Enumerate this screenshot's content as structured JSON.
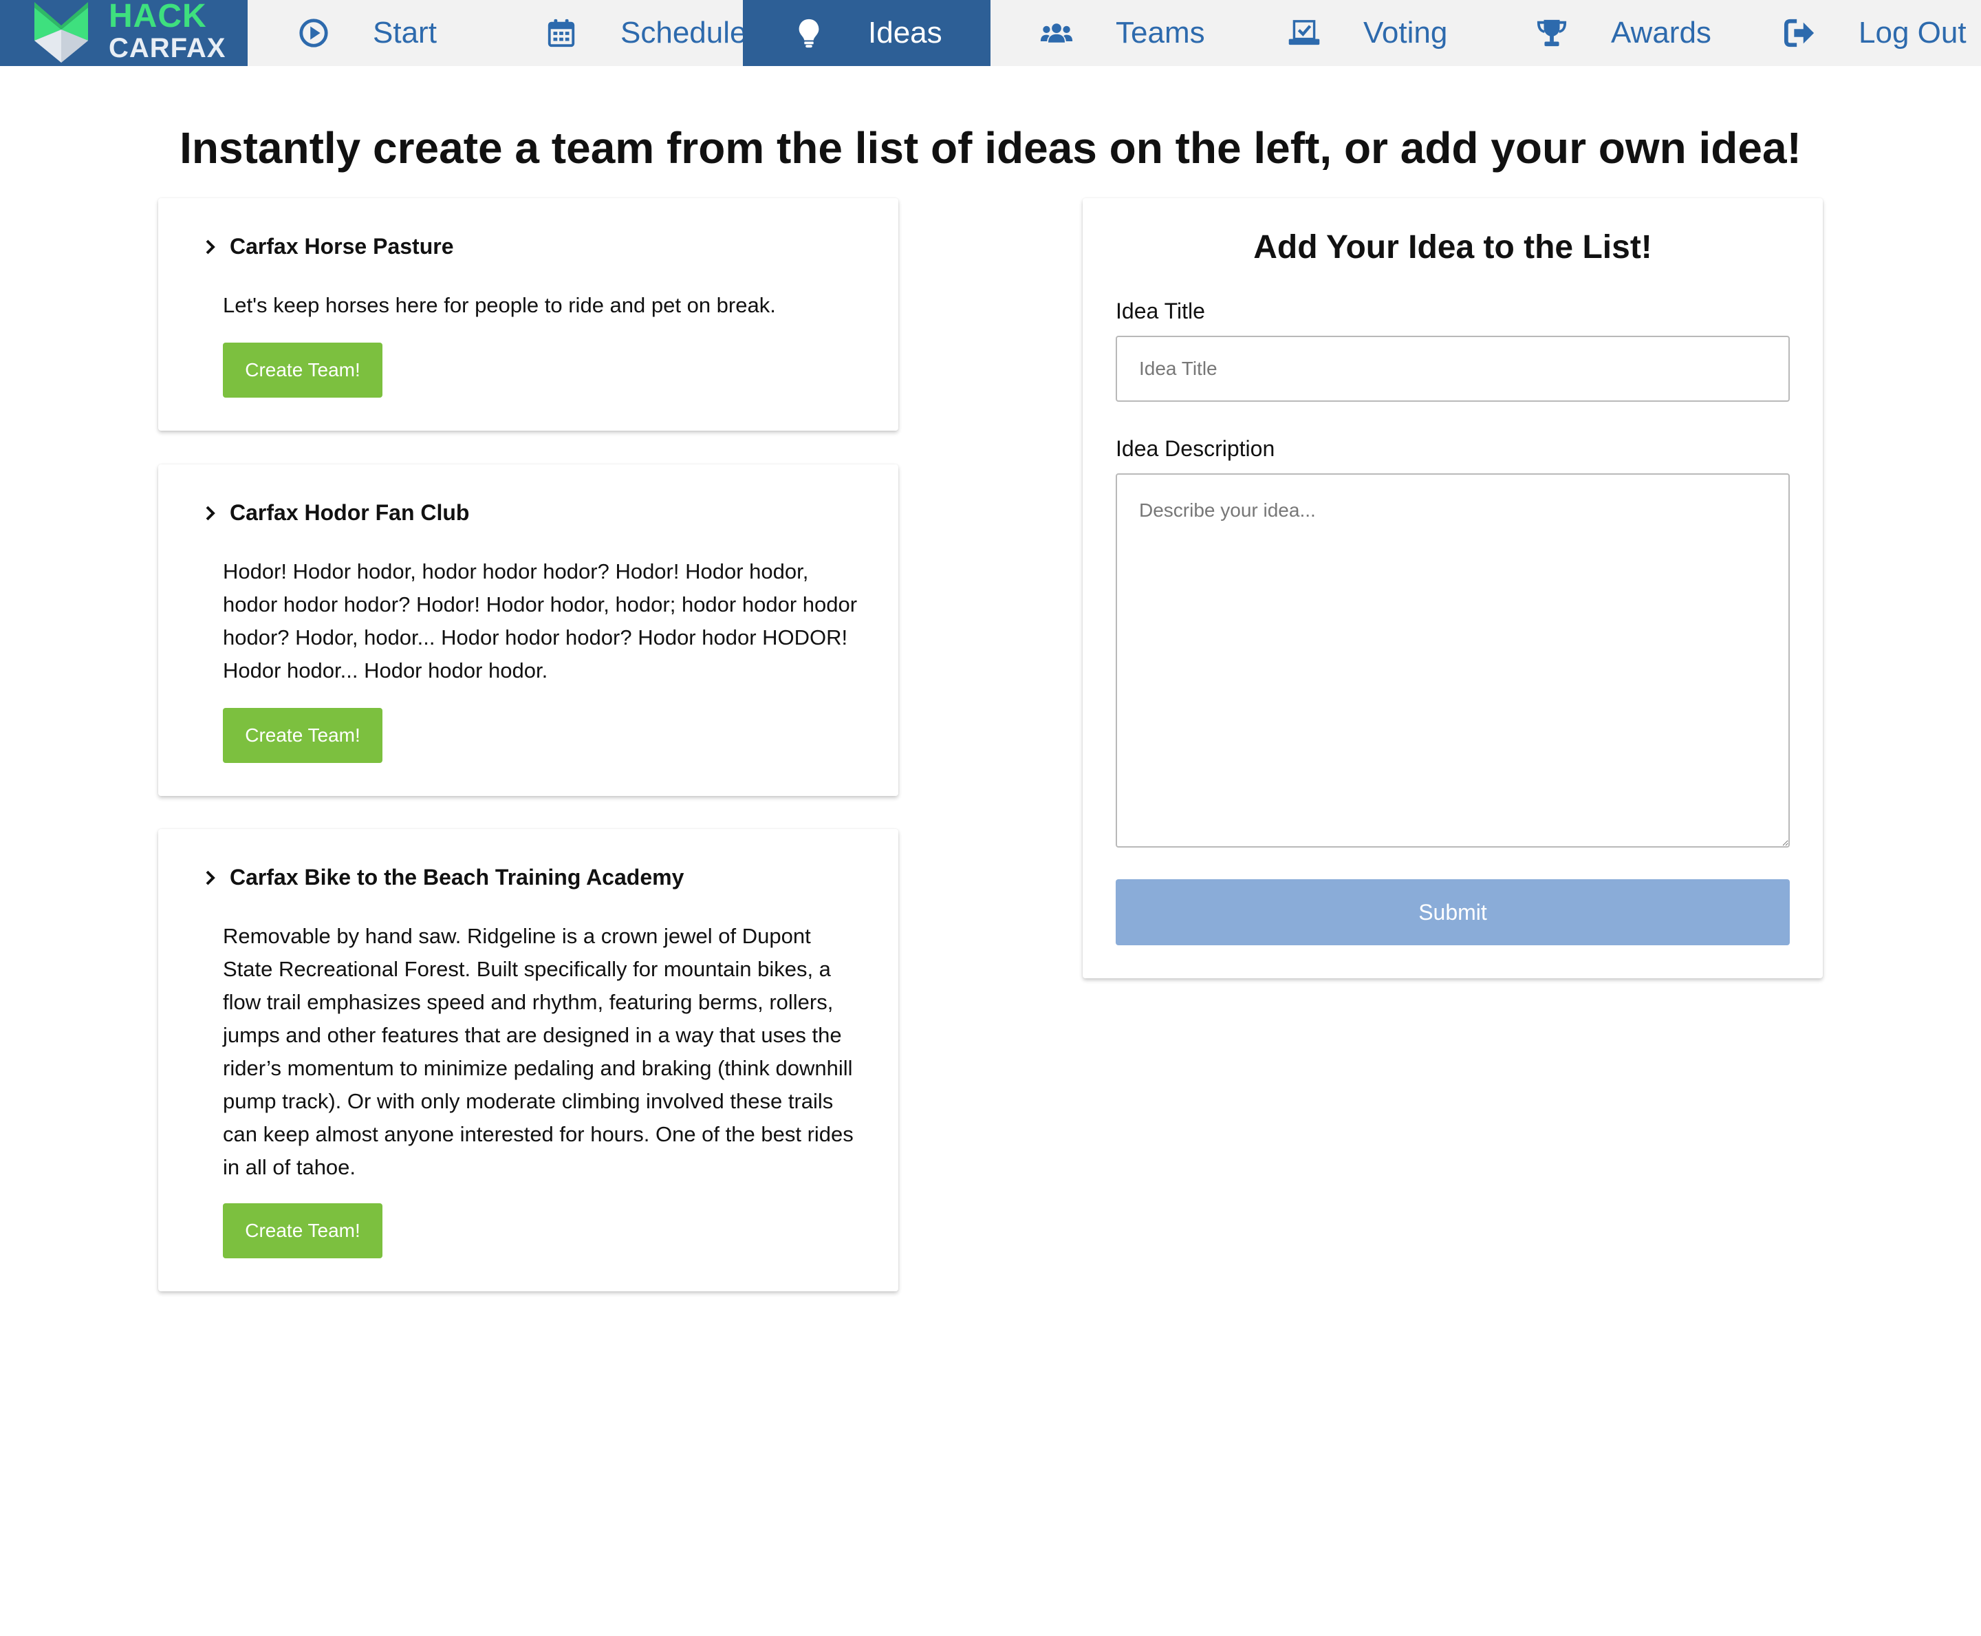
{
  "brand": {
    "line1": "HACK",
    "line2": "CARFAX"
  },
  "nav": [
    {
      "label": "Start",
      "icon": "play-circle-icon"
    },
    {
      "label": "Schedule",
      "icon": "calendar-icon"
    },
    {
      "label": "Ideas",
      "icon": "lightbulb-icon",
      "active": true
    },
    {
      "label": "Teams",
      "icon": "users-icon"
    },
    {
      "label": "Voting",
      "icon": "ballot-check-icon"
    },
    {
      "label": "Awards",
      "icon": "trophy-icon"
    },
    {
      "label": "Log Out",
      "icon": "sign-out-icon"
    }
  ],
  "page": {
    "title": "Instantly create a team from the list of ideas on the left, or add your own idea!"
  },
  "ideas": [
    {
      "title": "Carfax Horse Pasture",
      "description": "Let's keep horses here for people to ride and pet on break.",
      "button": "Create Team!"
    },
    {
      "title": "Carfax Hodor Fan Club",
      "description": "Hodor! Hodor hodor, hodor hodor hodor? Hodor! Hodor hodor, hodor hodor hodor? Hodor! Hodor hodor, hodor; hodor hodor hodor hodor? Hodor, hodor... Hodor hodor hodor? Hodor hodor HODOR! Hodor hodor... Hodor hodor hodor.",
      "button": "Create Team!"
    },
    {
      "title": "Carfax Bike to the Beach Training Academy",
      "description": "Removable by hand saw. Ridgeline is a crown jewel of Dupont State Recreational Forest. Built specifically for mountain bikes, a flow trail emphasizes speed and rhythm, featuring berms, rollers, jumps and other features that are designed in a way that uses the rider’s momentum to minimize pedaling and braking (think downhill pump track). Or with only moderate climbing involved these trails can keep almost anyone interested for hours. One of the best rides in all of tahoe.",
      "button": "Create Team!"
    }
  ],
  "form": {
    "title": "Add Your Idea to the List!",
    "title_label": "Idea Title",
    "title_placeholder": "Idea Title",
    "title_value": "",
    "desc_label": "Idea Description",
    "desc_placeholder": "Describe your idea...",
    "desc_value": "",
    "submit": "Submit"
  },
  "colors": {
    "nav_active": "#2d5f96",
    "nav_text": "#2d6aad",
    "logo_green": "#3ee07e",
    "create_button": "#7cc03f",
    "submit_button": "#8aacd8"
  }
}
